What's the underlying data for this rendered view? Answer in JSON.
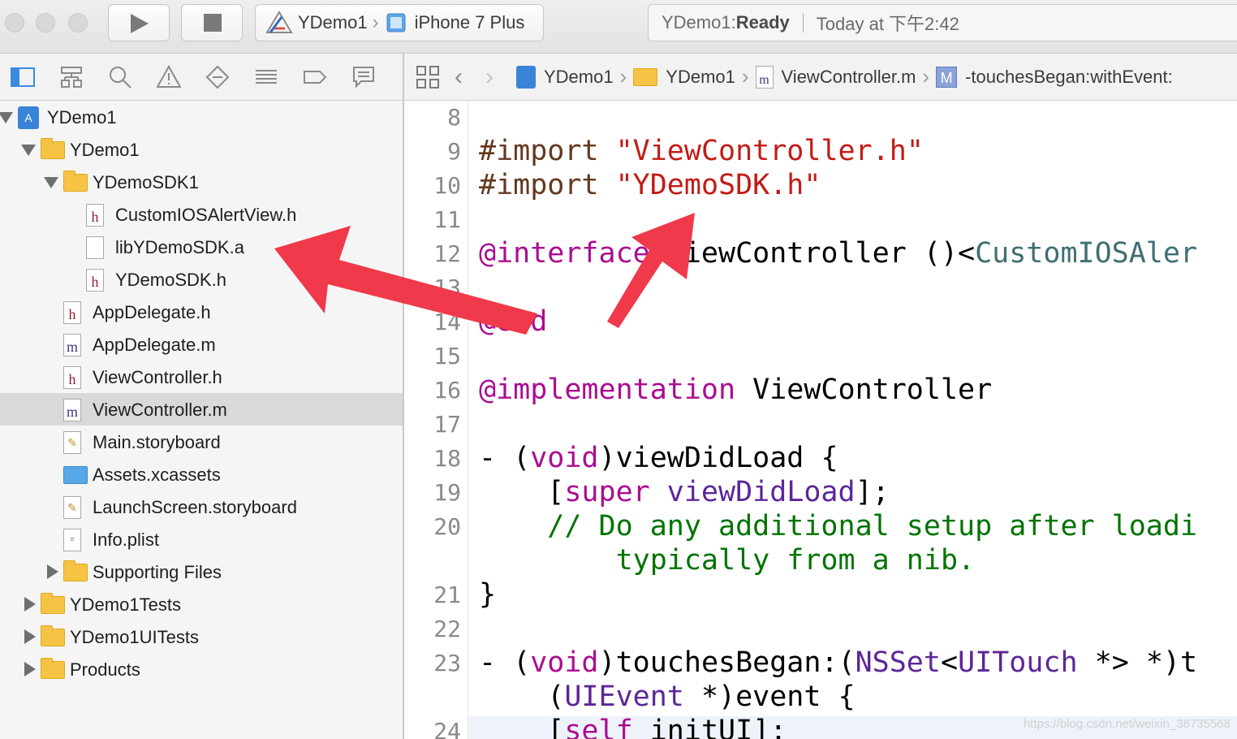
{
  "toolbar": {
    "run_icon": "play-icon",
    "stop_icon": "stop-icon",
    "scheme_target": "YDemo1",
    "scheme_device": "iPhone 7 Plus",
    "status_project": "YDemo1: ",
    "status_state": "Ready",
    "status_time": "Today at 下午2:42"
  },
  "navigator": {
    "tabs": [
      "folder-icon",
      "hierarchy-icon",
      "search-icon",
      "warning-icon",
      "breakpoint-diamond-icon",
      "list-icon",
      "tag-icon",
      "chat-icon"
    ],
    "tree": [
      {
        "label": "YDemo1",
        "kind": "project",
        "level": 0,
        "disclosure": "open",
        "selected": false
      },
      {
        "label": "YDemo1",
        "kind": "folder",
        "level": 1,
        "disclosure": "open",
        "selected": false
      },
      {
        "label": "YDemoSDK1",
        "kind": "folder",
        "level": 2,
        "disclosure": "open",
        "selected": false
      },
      {
        "label": "CustomIOSAlertView.h",
        "kind": "h",
        "level": 3,
        "disclosure": "none",
        "selected": false
      },
      {
        "label": "libYDemoSDK.a",
        "kind": "lib",
        "level": 3,
        "disclosure": "none",
        "selected": false
      },
      {
        "label": "YDemoSDK.h",
        "kind": "h",
        "level": 3,
        "disclosure": "none",
        "selected": false
      },
      {
        "label": "AppDelegate.h",
        "kind": "h",
        "level": 2,
        "disclosure": "none",
        "selected": false
      },
      {
        "label": "AppDelegate.m",
        "kind": "m",
        "level": 2,
        "disclosure": "none",
        "selected": false
      },
      {
        "label": "ViewController.h",
        "kind": "h",
        "level": 2,
        "disclosure": "none",
        "selected": false
      },
      {
        "label": "ViewController.m",
        "kind": "m",
        "level": 2,
        "disclosure": "none",
        "selected": true
      },
      {
        "label": "Main.storyboard",
        "kind": "storyboard",
        "level": 2,
        "disclosure": "none",
        "selected": false
      },
      {
        "label": "Assets.xcassets",
        "kind": "assets",
        "level": 2,
        "disclosure": "none",
        "selected": false
      },
      {
        "label": "LaunchScreen.storyboard",
        "kind": "storyboard",
        "level": 2,
        "disclosure": "none",
        "selected": false
      },
      {
        "label": "Info.plist",
        "kind": "plist",
        "level": 2,
        "disclosure": "none",
        "selected": false
      },
      {
        "label": "Supporting Files",
        "kind": "folder",
        "level": 2,
        "disclosure": "closed",
        "selected": false
      },
      {
        "label": "YDemo1Tests",
        "kind": "folder",
        "level": 1,
        "disclosure": "closed",
        "selected": false
      },
      {
        "label": "YDemo1UITests",
        "kind": "folder",
        "level": 1,
        "disclosure": "closed",
        "selected": false
      },
      {
        "label": "Products",
        "kind": "folder",
        "level": 1,
        "disclosure": "closed",
        "selected": false
      }
    ]
  },
  "jumpbar": {
    "project": "YDemo1",
    "group": "YDemo1",
    "file": "ViewController.m",
    "method": "-touchesBegan:withEvent:"
  },
  "editor": {
    "line_numbers": [
      "8",
      "9",
      "10",
      "11",
      "12",
      "13",
      "14",
      "15",
      "16",
      "17",
      "18",
      "19",
      "20",
      "21",
      "22",
      "23",
      "24"
    ],
    "import1_kw": "#import",
    "import1_str": "\"ViewController.h\"",
    "import2_kw": "#import",
    "import2_str": "\"YDemoSDK.h\"",
    "interface_kw": "@interface",
    "interface_name": " ViewController ",
    "interface_rest": "()<",
    "interface_protocol": "CustomIOSAler",
    "end_kw": "@end",
    "impl_kw": "@implementation",
    "impl_name": " ViewController",
    "vdl_dash": "- (",
    "vdl_void": "void",
    "vdl_rest": ")viewDidLoad {",
    "super_open": "    [",
    "super_kw": "super",
    "super_call": " viewDidLoad",
    "super_close": "];",
    "comment1": "    // Do any additional setup after loadi",
    "comment2": "        typically from a nib.",
    "brace_close": "}",
    "tb_dash": "- (",
    "tb_void": "void",
    "tb_name": ")touchesBegan:(",
    "tb_nsset": "NSSet",
    "tb_lt": "<",
    "tb_uitouch": "UITouch",
    "tb_rest": " *> *)t",
    "tb2_open": "    (",
    "tb2_uievent": "UIEvent",
    "tb2_rest": " *)event {",
    "self_open": "    [",
    "self_kw": "self",
    "self_rest": " initUI];"
  },
  "watermark": "https://blog.csdn.net/weixin_38735568",
  "colors": {
    "arrow": "#f0394a",
    "string": "#c41a16",
    "keyword": "#aa0d91",
    "comment": "#007400",
    "preprocessor": "#643820"
  }
}
